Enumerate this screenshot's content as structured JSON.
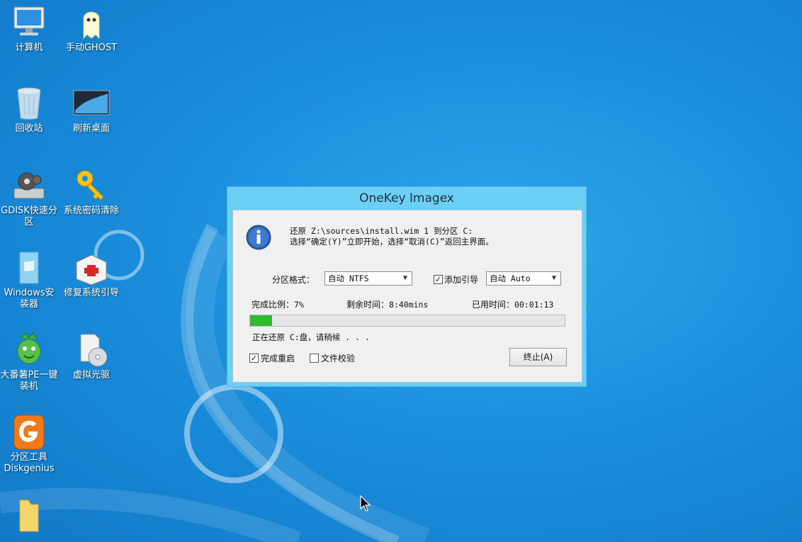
{
  "desktop": {
    "icons": [
      {
        "label": "计算机"
      },
      {
        "label": "手动GHOST"
      },
      {
        "label": "回收站"
      },
      {
        "label": "刷新桌面"
      },
      {
        "label": "GDISK快速分区"
      },
      {
        "label": "系统密码清除"
      },
      {
        "label": "Windows安装器"
      },
      {
        "label": "修复系统引导"
      },
      {
        "label": "大番薯PE一键装机"
      },
      {
        "label": "虚拟光驱"
      },
      {
        "label": "分区工具Diskgenius"
      },
      {
        "label": ""
      }
    ]
  },
  "dialog": {
    "title": "OneKey Imagex",
    "message_line1": "还原 Z:\\sources\\install.wim 1 到分区 C:",
    "message_line2": "选择“确定(Y)”立即开始，选择“取消(C)”返回主界面。",
    "partition_format_label": "分区格式：",
    "partition_format_value": "自动 NTFS",
    "add_boot_label": "添加引导",
    "add_boot_checked": true,
    "boot_mode_value": "自动 Auto",
    "progress_label": "完成比例：",
    "progress_value": "7%",
    "progress_fraction": 0.07,
    "remaining_label": "剩余时间：",
    "remaining_value": "8:40mins",
    "elapsed_label": "已用时间：",
    "elapsed_value": "00:01:13",
    "status_text": "正在还原 C:盘，请稍候 . . .",
    "restart_label": "完成重启",
    "restart_checked": true,
    "verify_label": "文件校验",
    "verify_checked": false,
    "stop_button": "终止(A)"
  },
  "colors": {
    "dialog_frame": "#6ccff6",
    "progress_fill": "#2fbb2f",
    "desktop_bg": "#1b8fdc"
  }
}
